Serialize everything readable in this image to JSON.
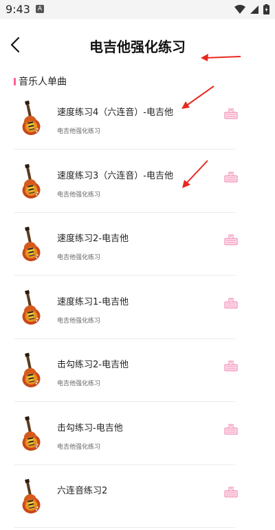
{
  "status_bar": {
    "time": "9:43",
    "notif_letter": "A"
  },
  "header": {
    "title": "电吉他强化练习"
  },
  "section": {
    "title": "音乐人单曲"
  },
  "songs": [
    {
      "title": "速度练习4（六连音）-电吉他",
      "subtitle": "电吉他强化练习"
    },
    {
      "title": "速度练习3（六连音）-电吉他",
      "subtitle": "电吉他强化练习"
    },
    {
      "title": "速度练习2-电吉他",
      "subtitle": "电吉他强化练习"
    },
    {
      "title": "速度练习1-电吉他",
      "subtitle": "电吉他强化练习"
    },
    {
      "title": "击勾练习2-电吉他",
      "subtitle": "电吉他强化练习"
    },
    {
      "title": "击勾练习-电吉他",
      "subtitle": "电吉他强化练习"
    },
    {
      "title": "六连音练习2",
      "subtitle": ""
    }
  ],
  "colors": {
    "accent": "#ff5c9a",
    "annotation_red": "#e8281e",
    "pink_icon": "#f07aa8"
  }
}
